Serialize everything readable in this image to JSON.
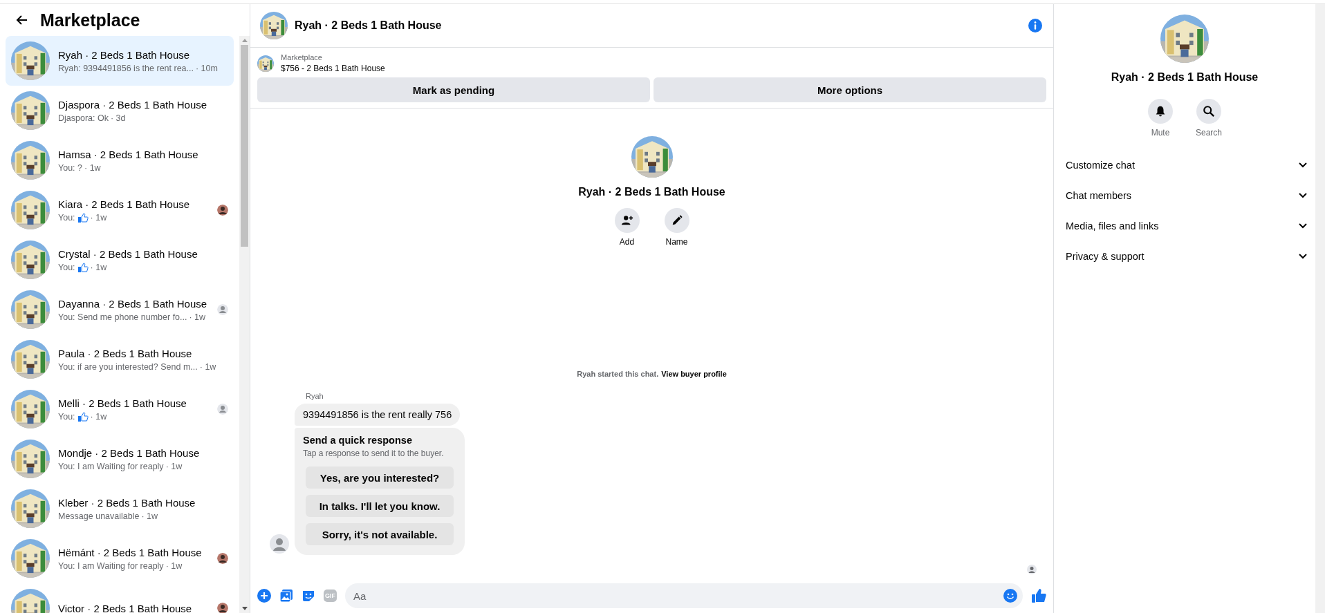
{
  "sidebar": {
    "title": "Marketplace",
    "conversations": [
      {
        "title": "Ryah · 2 Beds 1 Bath House",
        "kind": "text",
        "preview": "Ryah: 9394491856 is the rent rea...",
        "time": "· 10m",
        "selected": true
      },
      {
        "title": "Djaspora · 2 Beds 1 Bath House",
        "kind": "text",
        "preview": "Djaspora: Ok",
        "time": "· 3d",
        "selected": false
      },
      {
        "title": "Hamsa · 2 Beds 1 Bath House",
        "kind": "text",
        "preview": "You: ?",
        "time": "· 1w",
        "selected": false
      },
      {
        "title": "Kiara · 2 Beds 1 Bath House",
        "kind": "like",
        "preview": "You:",
        "time": "· 1w",
        "selected": false
      },
      {
        "title": "Crystal · 2 Beds 1 Bath House",
        "kind": "like",
        "preview": "You:",
        "time": "· 1w",
        "selected": false
      },
      {
        "title": "Dayanna · 2 Beds 1 Bath House",
        "kind": "text",
        "preview": "You: Send me phone number fo...",
        "time": "· 1w",
        "selected": false,
        "seen": {
          "kind": "person"
        }
      },
      {
        "title": "Paula · 2 Beds 1 Bath House",
        "kind": "text",
        "preview": "You: if are you interested? Send m...",
        "time": " · 1w",
        "selected": false
      },
      {
        "title": "Melli · 2 Beds 1 Bath House",
        "kind": "like",
        "preview": "You:",
        "time": "· 1w",
        "selected": false,
        "seen": {
          "kind": "person"
        }
      },
      {
        "title": "Mondje · 2 Beds 1 Bath House",
        "kind": "text",
        "preview": "You: I am Waiting for reaply",
        "time": "· 1w",
        "selected": false
      },
      {
        "title": "Kleber · 2 Beds 1 Bath House",
        "kind": "text",
        "preview": "Message unavailable",
        "time": "· 1w",
        "selected": false
      },
      {
        "title": "Hëmánt · 2 Beds 1 Bath House",
        "kind": "text",
        "preview": "You: I am Waiting for reaply",
        "time": "· 1w",
        "selected": false
      },
      {
        "title": "Victor · 2 Beds 1 Bath House",
        "kind": "title_only",
        "selected": false
      }
    ]
  },
  "chat": {
    "title": "Ryah · 2 Beds 1 Bath House",
    "listing": {
      "label": "Marketplace",
      "title": "$756 - 2 Beds 1 Bath House"
    },
    "actions": [
      "Mark as pending",
      "More options"
    ],
    "profile": {
      "name": "Ryah · 2 Beds 1 Bath House",
      "actions": [
        {
          "label": "Add",
          "kind": "add"
        },
        {
          "label": "Name",
          "kind": "edit"
        }
      ]
    },
    "notice": {
      "text": "Ryah started this chat.",
      "link": "View buyer profile"
    },
    "message": {
      "sender": "Ryah",
      "text": "9394491856 is the rent really 756"
    },
    "quick_response": {
      "title": "Send a quick response",
      "hint": "Tap a response to send it to the buyer.",
      "options": [
        "Yes, are you interested?",
        "In talks. I'll let you know.",
        "Sorry, it's not available."
      ]
    },
    "composer": {
      "gif": "GIF",
      "placeholder": "Aa"
    }
  },
  "details": {
    "name": "Ryah · 2 Beds 1 Bath House",
    "actions": [
      {
        "label": "Mute",
        "kind": "bell"
      },
      {
        "label": "Search",
        "kind": "search"
      }
    ],
    "sections": [
      {
        "label": "Customize chat",
        "expanded": false
      },
      {
        "label": "Chat members",
        "expanded": false
      },
      {
        "label": "Media, files and links",
        "expanded": false
      },
      {
        "label": "Privacy & support",
        "expanded": false
      }
    ]
  }
}
